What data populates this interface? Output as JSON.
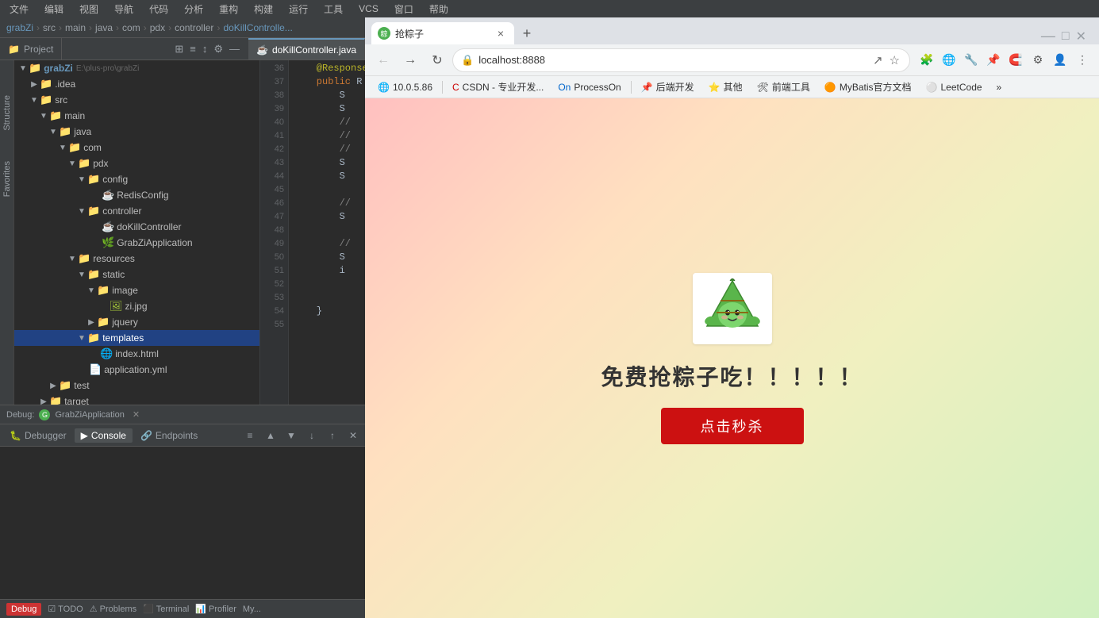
{
  "ide": {
    "menubar": {
      "items": [
        "文件",
        "编辑",
        "视图",
        "导航",
        "代码",
        "分析",
        "重构",
        "构建",
        "运行",
        "工具",
        "VCS",
        "窗口",
        "帮助"
      ]
    },
    "pathbar": {
      "segments": [
        "grabZi",
        "src",
        "main",
        "java",
        "com",
        "pdx",
        "controller",
        "doKillControlle..."
      ]
    },
    "project_tab": "Project",
    "tab_icons": [
      "⊞",
      "≡",
      "↕",
      "⚙",
      "—"
    ],
    "active_file": "doKillController.java",
    "tree": {
      "title": "Project",
      "items": [
        {
          "indent": 0,
          "arrow": "▼",
          "icon": "📁",
          "label": "grabZi",
          "path": "E:\\plus-pro\\grabZi",
          "selected": false,
          "type": "root"
        },
        {
          "indent": 1,
          "arrow": "▶",
          "icon": "📁",
          "label": ".idea",
          "selected": false,
          "type": "folder"
        },
        {
          "indent": 1,
          "arrow": "▼",
          "icon": "📁",
          "label": "src",
          "selected": false,
          "type": "folder"
        },
        {
          "indent": 2,
          "arrow": "▼",
          "icon": "📁",
          "label": "main",
          "selected": false,
          "type": "folder"
        },
        {
          "indent": 3,
          "arrow": "▼",
          "icon": "📁",
          "label": "java",
          "selected": false,
          "type": "folder"
        },
        {
          "indent": 4,
          "arrow": "▼",
          "icon": "📁",
          "label": "com",
          "selected": false,
          "type": "folder"
        },
        {
          "indent": 5,
          "arrow": "▼",
          "icon": "📁",
          "label": "pdx",
          "selected": false,
          "type": "folder"
        },
        {
          "indent": 6,
          "arrow": "▼",
          "icon": "📁",
          "label": "config",
          "selected": false,
          "type": "folder"
        },
        {
          "indent": 7,
          "arrow": " ",
          "icon": "☕",
          "label": "RedisConfig",
          "selected": false,
          "type": "java"
        },
        {
          "indent": 6,
          "arrow": "▼",
          "icon": "📁",
          "label": "controller",
          "selected": false,
          "type": "folder"
        },
        {
          "indent": 7,
          "arrow": " ",
          "icon": "☕",
          "label": "doKillController",
          "selected": false,
          "type": "java"
        },
        {
          "indent": 7,
          "arrow": " ",
          "icon": "🌿",
          "label": "GrabZiApplication",
          "selected": false,
          "type": "spring"
        },
        {
          "indent": 5,
          "arrow": "▼",
          "icon": "📁",
          "label": "resources",
          "selected": false,
          "type": "folder"
        },
        {
          "indent": 6,
          "arrow": "▼",
          "icon": "📁",
          "label": "static",
          "selected": false,
          "type": "folder"
        },
        {
          "indent": 7,
          "arrow": "▼",
          "icon": "📁",
          "label": "image",
          "selected": false,
          "type": "folder"
        },
        {
          "indent": 8,
          "arrow": " ",
          "icon": "🖼",
          "label": "zi.jpg",
          "selected": false,
          "type": "image"
        },
        {
          "indent": 7,
          "arrow": "▶",
          "icon": "📁",
          "label": "jquery",
          "selected": false,
          "type": "folder"
        },
        {
          "indent": 6,
          "arrow": "▼",
          "icon": "📁",
          "label": "templates",
          "selected": true,
          "type": "folder"
        },
        {
          "indent": 7,
          "arrow": " ",
          "icon": "🌐",
          "label": "index.html",
          "selected": false,
          "type": "html"
        },
        {
          "indent": 6,
          "arrow": " ",
          "icon": "📄",
          "label": "application.yml",
          "selected": false,
          "type": "yml"
        },
        {
          "indent": 3,
          "arrow": "▶",
          "icon": "📁",
          "label": "test",
          "selected": false,
          "type": "folder"
        },
        {
          "indent": 2,
          "arrow": "▶",
          "icon": "📁",
          "label": "target",
          "selected": false,
          "type": "folder"
        }
      ]
    },
    "editor": {
      "lines": [
        {
          "num": 36,
          "code": "    @ResponseBody"
        },
        {
          "num": 37,
          "code": "    public "
        },
        {
          "num": 38,
          "code": "        S"
        },
        {
          "num": 39,
          "code": "        S"
        },
        {
          "num": 40,
          "code": "        //"
        },
        {
          "num": 41,
          "code": "        //"
        },
        {
          "num": 42,
          "code": "        //"
        },
        {
          "num": 43,
          "code": "        S"
        },
        {
          "num": 44,
          "code": "        S"
        },
        {
          "num": 45,
          "code": ""
        },
        {
          "num": 46,
          "code": "        //"
        },
        {
          "num": 47,
          "code": "        S"
        },
        {
          "num": 48,
          "code": ""
        },
        {
          "num": 49,
          "code": "        //"
        },
        {
          "num": 50,
          "code": "        S"
        },
        {
          "num": 51,
          "code": "        i"
        },
        {
          "num": 52,
          "code": ""
        },
        {
          "num": 53,
          "code": ""
        },
        {
          "num": 54,
          "code": "    }"
        },
        {
          "num": 55,
          "code": ""
        }
      ]
    },
    "bottom": {
      "debug_label": "Debug:",
      "app_name": "GrabZiApplication",
      "tabs": [
        {
          "label": "Debugger",
          "active": false
        },
        {
          "label": "Console",
          "active": true
        },
        {
          "label": "Endpoints",
          "active": false
        }
      ],
      "toolbar_buttons": [
        "≡",
        "▲",
        "▼",
        "↓",
        "↑",
        "✕"
      ]
    },
    "statusbar": {
      "left": {
        "debug": "Debug",
        "todo": "TODO",
        "problems": "Problems",
        "terminal": "Terminal",
        "profiler": "Profiler",
        "my": "My..."
      }
    },
    "vertical_tabs": [
      "Structure",
      "Favorites"
    ]
  },
  "browser": {
    "tab": {
      "favicon": "粽",
      "label": "抢粽子",
      "close": "×"
    },
    "new_tab_btn": "+",
    "nav": {
      "back_disabled": true,
      "forward_disabled": false,
      "reload": "↻",
      "url": "localhost:8888"
    },
    "bookmarks": [
      {
        "icon": "🌐",
        "label": "10.0.5.86"
      },
      {
        "icon": "🔴",
        "label": "CSDN - 专业开发..."
      },
      {
        "icon": "🟦",
        "label": "ProcessOn"
      },
      {
        "icon": "📌",
        "label": "后端开发"
      },
      {
        "icon": "⭐",
        "label": "其他"
      },
      {
        "icon": "🛠",
        "label": "前端工具"
      },
      {
        "icon": "🟠",
        "label": "MyBatis官方文档"
      },
      {
        "icon": "⚪",
        "label": "LeetCode"
      },
      {
        "icon": "»",
        "label": ""
      }
    ],
    "page": {
      "title": "免费抢粽子吃！！！！！",
      "button_label": "点击秒杀",
      "button_color": "#cc1111"
    }
  }
}
